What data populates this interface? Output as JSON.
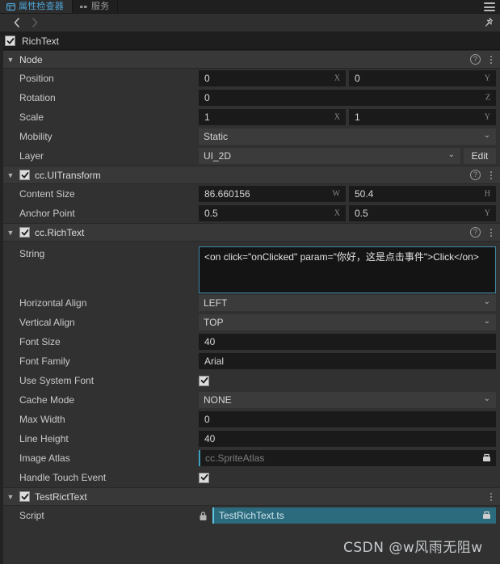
{
  "window": {
    "tabs": [
      {
        "label": "属性检查器",
        "icon": "inspector-icon",
        "active": true
      },
      {
        "label": "服务",
        "icon": "grid-icon",
        "active": false
      }
    ],
    "menu_icon": "hamburger-icon",
    "pin_icon": "pin-icon",
    "nav_back_icon": "chevron-left-icon",
    "nav_forward_icon": "chevron-right-icon"
  },
  "node": {
    "name": "RichText",
    "enabled": true
  },
  "sections": [
    {
      "id": "node",
      "title": "Node",
      "has_checkbox": false,
      "help_icon": "help-circle-icon",
      "menu_icon": "kebab-menu-icon"
    },
    {
      "id": "uitransform",
      "title": "cc.UITransform",
      "has_checkbox": true,
      "checked": true,
      "help_icon": "help-circle-icon",
      "menu_icon": "kebab-menu-icon"
    },
    {
      "id": "richtext",
      "title": "cc.RichText",
      "has_checkbox": true,
      "checked": true,
      "help_icon": "help-circle-icon",
      "menu_icon": "kebab-menu-icon"
    },
    {
      "id": "testricttext",
      "title": "TestRictText",
      "has_checkbox": true,
      "checked": true,
      "help_icon": "",
      "menu_icon": "kebab-menu-icon"
    }
  ],
  "node_props": {
    "position": {
      "label": "Position",
      "x": "0",
      "y": "0",
      "x_axis": "X",
      "y_axis": "Y"
    },
    "rotation": {
      "label": "Rotation",
      "z": "0",
      "z_axis": "Z"
    },
    "scale": {
      "label": "Scale",
      "x": "1",
      "y": "1",
      "x_axis": "X",
      "y_axis": "Y"
    },
    "mobility": {
      "label": "Mobility",
      "value": "Static"
    },
    "layer": {
      "label": "Layer",
      "value": "UI_2D",
      "edit_label": "Edit"
    }
  },
  "uitransform_props": {
    "content_size": {
      "label": "Content Size",
      "w": "86.660156",
      "h": "50.4",
      "w_axis": "W",
      "h_axis": "H"
    },
    "anchor_point": {
      "label": "Anchor Point",
      "x": "0.5",
      "y": "0.5",
      "x_axis": "X",
      "y_axis": "Y"
    }
  },
  "richtext_props": {
    "string": {
      "label": "String",
      "value": "<on click=\"onClicked\" param=\"你好，这是点击事件\">Click</on>"
    },
    "horizontal_align": {
      "label": "Horizontal Align",
      "value": "LEFT"
    },
    "vertical_align": {
      "label": "Vertical Align",
      "value": "TOP"
    },
    "font_size": {
      "label": "Font Size",
      "value": "40"
    },
    "font_family": {
      "label": "Font Family",
      "value": "Arial"
    },
    "use_system_font": {
      "label": "Use System Font",
      "checked": true
    },
    "cache_mode": {
      "label": "Cache Mode",
      "value": "NONE"
    },
    "max_width": {
      "label": "Max Width",
      "value": "0"
    },
    "line_height": {
      "label": "Line Height",
      "value": "40"
    },
    "image_atlas": {
      "label": "Image Atlas",
      "placeholder": "cc.SpriteAtlas",
      "icon": "locate-asset-icon"
    },
    "handle_touch_event": {
      "label": "Handle Touch Event",
      "checked": true
    }
  },
  "script_props": {
    "script": {
      "label": "Script",
      "value": "TestRichText.ts",
      "lock_icon": "lock-icon",
      "locate_icon": "locate-asset-icon"
    }
  },
  "watermark": {
    "text": "CSDN @w风雨无阻w"
  },
  "colors": {
    "accent_tab": "#4ea3d6",
    "focus_border": "#3f8aa8",
    "asset_accent": "#3f9fc0",
    "asset_selected_bg": "#2c6a7d",
    "panel_bg": "#313131",
    "section_bg": "#383838",
    "field_bg": "#1a1a1a"
  }
}
